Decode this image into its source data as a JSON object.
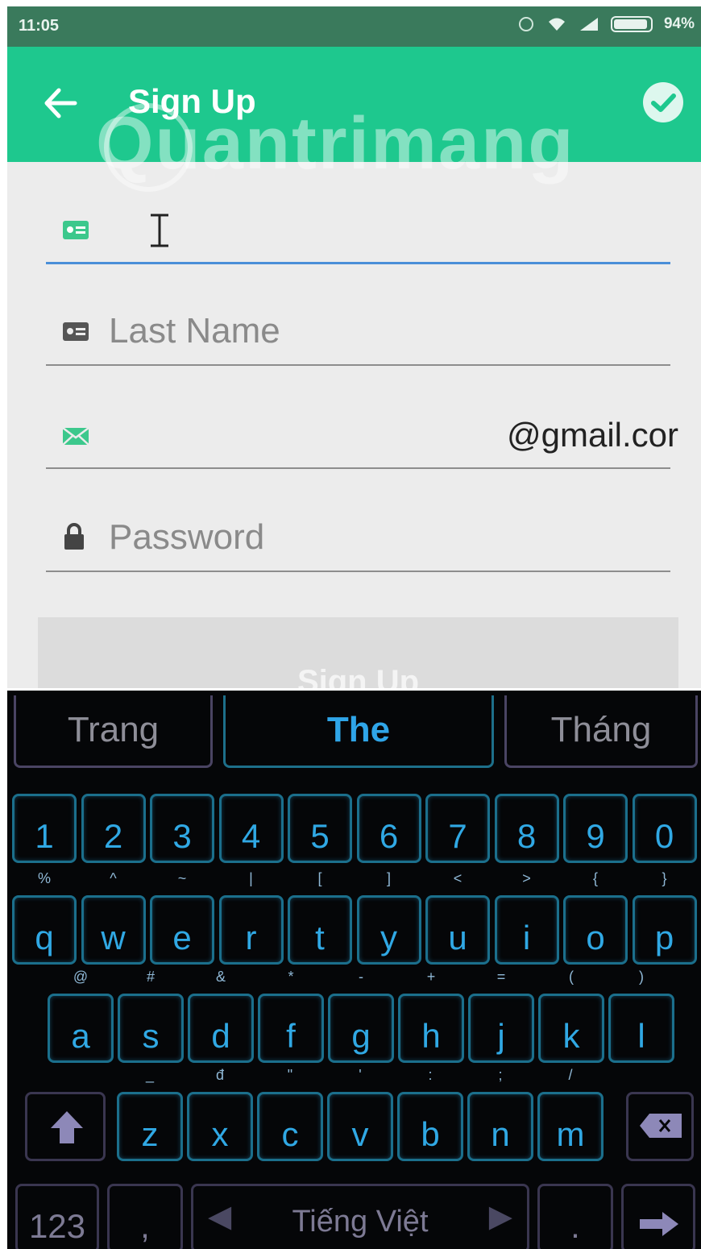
{
  "status_bar": {
    "time": "11:05",
    "battery": "94%",
    "battery_level": 0.94
  },
  "app_bar": {
    "title": "Sign Up"
  },
  "watermark": "Quantrimang",
  "form": {
    "first_name": {
      "value": ""
    },
    "last_name": {
      "placeholder": "Last Name"
    },
    "email": {
      "value": "@gmail.cor"
    },
    "password": {
      "placeholder": "Password"
    },
    "submit_label": "Sign Up"
  },
  "keyboard": {
    "suggestions": [
      "Trang",
      "The",
      "Tháng"
    ],
    "number_row": [
      "1",
      "2",
      "3",
      "4",
      "5",
      "6",
      "7",
      "8",
      "9",
      "0"
    ],
    "row1": {
      "keys": [
        "q",
        "w",
        "e",
        "r",
        "t",
        "y",
        "u",
        "i",
        "o",
        "p"
      ],
      "secondary": [
        "%",
        "^",
        "~",
        "|",
        "[",
        "]",
        "<",
        ">",
        "{",
        "}"
      ]
    },
    "row2": {
      "keys": [
        "a",
        "s",
        "d",
        "f",
        "g",
        "h",
        "j",
        "k",
        "l"
      ],
      "secondary": [
        "@",
        "#",
        "&",
        "*",
        "-",
        "+",
        "=",
        "(",
        ")"
      ]
    },
    "row3": {
      "keys": [
        "z",
        "x",
        "c",
        "v",
        "b",
        "n",
        "m"
      ],
      "secondary": [
        "_",
        "đ",
        "\"",
        "'",
        ":",
        ";",
        "/"
      ]
    },
    "bottom": {
      "mode": "123",
      "comma": ",",
      "space_label": "Tiếng Việt",
      "period": "."
    },
    "accent_color": "#30a8e4"
  }
}
